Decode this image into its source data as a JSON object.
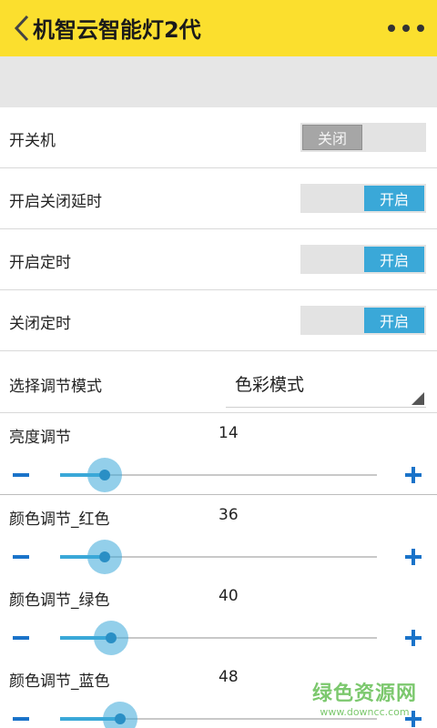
{
  "header": {
    "title": "机智云智能灯2代",
    "back_icon": "chevron-left-icon",
    "more_icon": "more-horizontal-icon",
    "background": "#fbdf2e"
  },
  "settings": {
    "power": {
      "label": "开关机",
      "state": "关闭",
      "on": false
    },
    "close_delay": {
      "label": "开启关闭延时",
      "state": "开启",
      "on": true
    },
    "timer_on": {
      "label": "开启定时",
      "state": "开启",
      "on": true
    },
    "timer_off": {
      "label": "关闭定时",
      "state": "开启",
      "on": true
    },
    "mode": {
      "label": "选择调节模式",
      "value": "色彩模式"
    }
  },
  "sliders": [
    {
      "label": "亮度调节",
      "value": "14",
      "level": 0.14
    },
    {
      "label": "颜色调节_红色",
      "value": "36",
      "level": 0.14
    },
    {
      "label": "颜色调节_绿色",
      "value": "40",
      "level": 0.16
    },
    {
      "label": "颜色调节_蓝色",
      "value": "48",
      "level": 0.19
    }
  ],
  "accent_color": "#3aa8d8",
  "button_color": "#1a73c9",
  "watermark": {
    "text": "绿色资源网",
    "url": "www.downcc.com"
  }
}
